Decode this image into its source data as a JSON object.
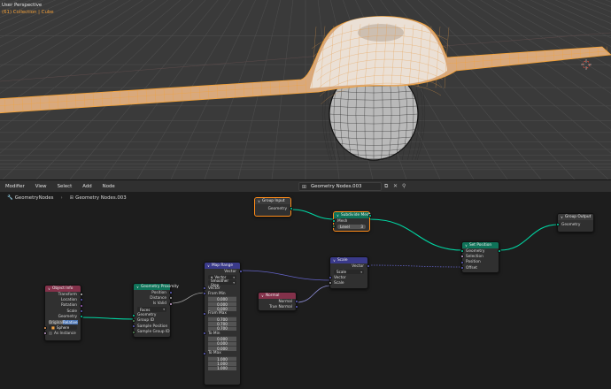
{
  "viewport": {
    "title": "User Perspective",
    "subtitle": "(61) Collection | Cube",
    "colors": {
      "background": "#3a3a3a",
      "grid": "#555555",
      "selected_wire": "#f5a134"
    }
  },
  "editor_header": {
    "menu": [
      "Modifier",
      "View",
      "Select",
      "Add",
      "Node"
    ],
    "node_tree": "Geometry Nodes.003"
  },
  "breadcrumb": [
    "GeometryNodes",
    "Geometry Nodes.003"
  ],
  "nodes": {
    "group_input": {
      "title": "Group Input",
      "out_geometry": "Geometry",
      "color": "#3b3b3b"
    },
    "subdivide": {
      "title": "Subdivide Mesh",
      "in_mesh": "Mesh",
      "level_label": "Level",
      "level_value": "3",
      "out_mesh": "Mesh",
      "color": "#0f7359"
    },
    "group_output": {
      "title": "Group Output",
      "in_geometry": "Geometry",
      "color": "#3b3b3b"
    },
    "set_position": {
      "title": "Set Position",
      "geometry": "Geometry",
      "selection": "Selection",
      "position": "Position",
      "offset": "Offset",
      "color": "#0f7359"
    },
    "scale": {
      "title": "Scale",
      "out_vector": "Vector",
      "op": "Scale",
      "in_vector": "Vector",
      "in_scale": "Scale",
      "color": "#3a3a8a"
    },
    "map_range": {
      "title": "Map Range",
      "out_vector": "Vector",
      "type": "Vector",
      "mode": "Smoother Step",
      "vector": "Vector",
      "from_min": "From Min",
      "from_min_vals": [
        "0.000",
        "0.000",
        "0.000"
      ],
      "from_max": "From Max",
      "from_max_vals": [
        "0.700",
        "0.700",
        "0.700"
      ],
      "to_min": "To Min",
      "to_min_vals": [
        "0.000",
        "0.000",
        "0.000"
      ],
      "to_max": "To Max",
      "to_max_vals": [
        "1.000",
        "1.000",
        "1.000"
      ],
      "color": "#3a3a8a"
    },
    "normal": {
      "title": "Normal",
      "out_normal": "Normal",
      "out_true_normal": "True Normal",
      "color": "#83314a"
    },
    "geometry_proximity": {
      "title": "Geometry Proximity",
      "out_position": "Position",
      "out_distance": "Distance",
      "out_is_valid": "Is Valid",
      "mode": "Faces",
      "in_geometry": "Geometry",
      "in_group_id": "Group ID",
      "in_sample_position": "Sample Position",
      "in_sample_group_id": "Sample Group ID",
      "color": "#0f7359"
    },
    "object_info": {
      "title": "Object Info",
      "transform": "Transform",
      "location": "Location",
      "rotation": "Rotation",
      "scale": "Scale",
      "geometry": "Geometry",
      "original": "Original",
      "relative": "Relative",
      "object": "Sphere",
      "as_instance": "As Instance",
      "color": "#83314a"
    }
  }
}
